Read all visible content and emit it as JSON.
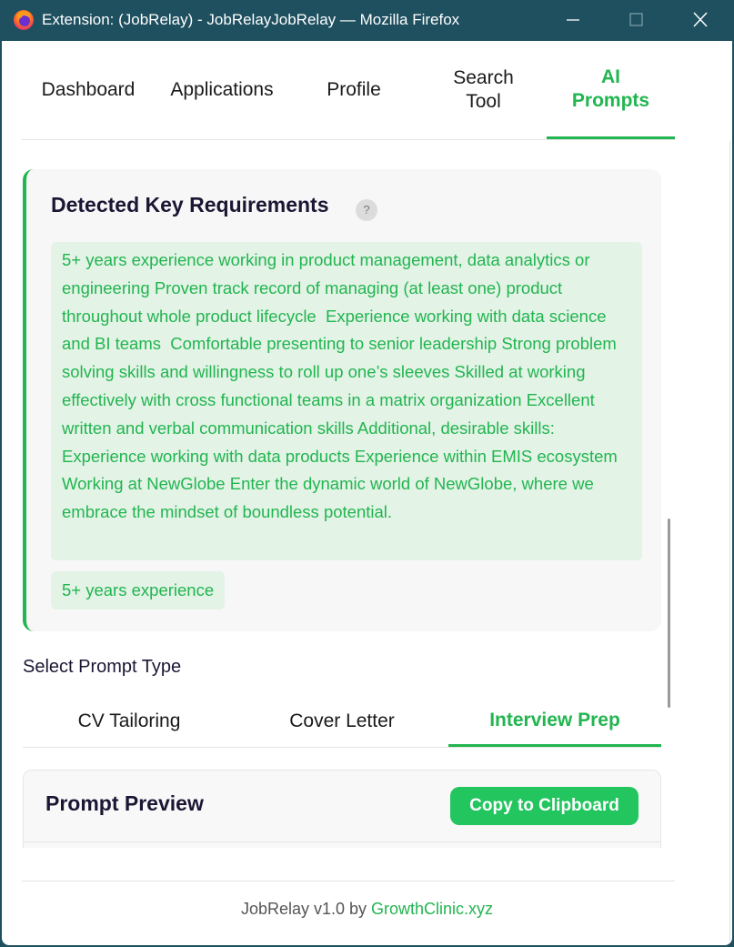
{
  "window": {
    "title": "Extension: (JobRelay) - JobRelayJobRelay — Mozilla Firefox"
  },
  "nav": {
    "tabs": [
      {
        "label": "Dashboard"
      },
      {
        "label": "Applications"
      },
      {
        "label": "Profile"
      },
      {
        "label": "Search\nTool"
      },
      {
        "label": "AI\nPrompts",
        "active": true
      }
    ]
  },
  "requirements": {
    "title": "Detected Key Requirements",
    "help": "?",
    "text": "5+ years experience working in product management, data analytics or engineering Proven track record of managing (at least one) product throughout whole product lifecycle  Experience working with data science and BI teams  Comfortable presenting to senior leadership Strong problem solving skills and willingness to roll up one’s sleeves Skilled at working effectively with cross functional teams in a matrix organization Excellent written and verbal communication skills Additional, desirable skills:  Experience working with data products Experience within EMIS ecosystem  Working at NewGlobe Enter the dynamic world of NewGlobe, where we embrace the mindset of boundless potential.",
    "chip": "5+ years experience"
  },
  "prompt": {
    "select_label": "Select Prompt Type",
    "tabs": [
      {
        "label": "CV Tailoring"
      },
      {
        "label": "Cover Letter"
      },
      {
        "label": "Interview Prep",
        "active": true
      }
    ],
    "preview_title": "Prompt Preview",
    "copy_label": "Copy to Clipboard"
  },
  "footer": {
    "prefix": "JobRelay v1.0 by ",
    "link": "GrowthClinic.xyz"
  },
  "colors": {
    "accent": "#22b550",
    "button": "#22c55e",
    "titlebar": "#1e5060",
    "chip_bg": "#e3f3e6"
  },
  "icons": [
    "firefox-logo-icon",
    "minimize-icon",
    "maximize-icon",
    "close-icon",
    "help-icon"
  ]
}
